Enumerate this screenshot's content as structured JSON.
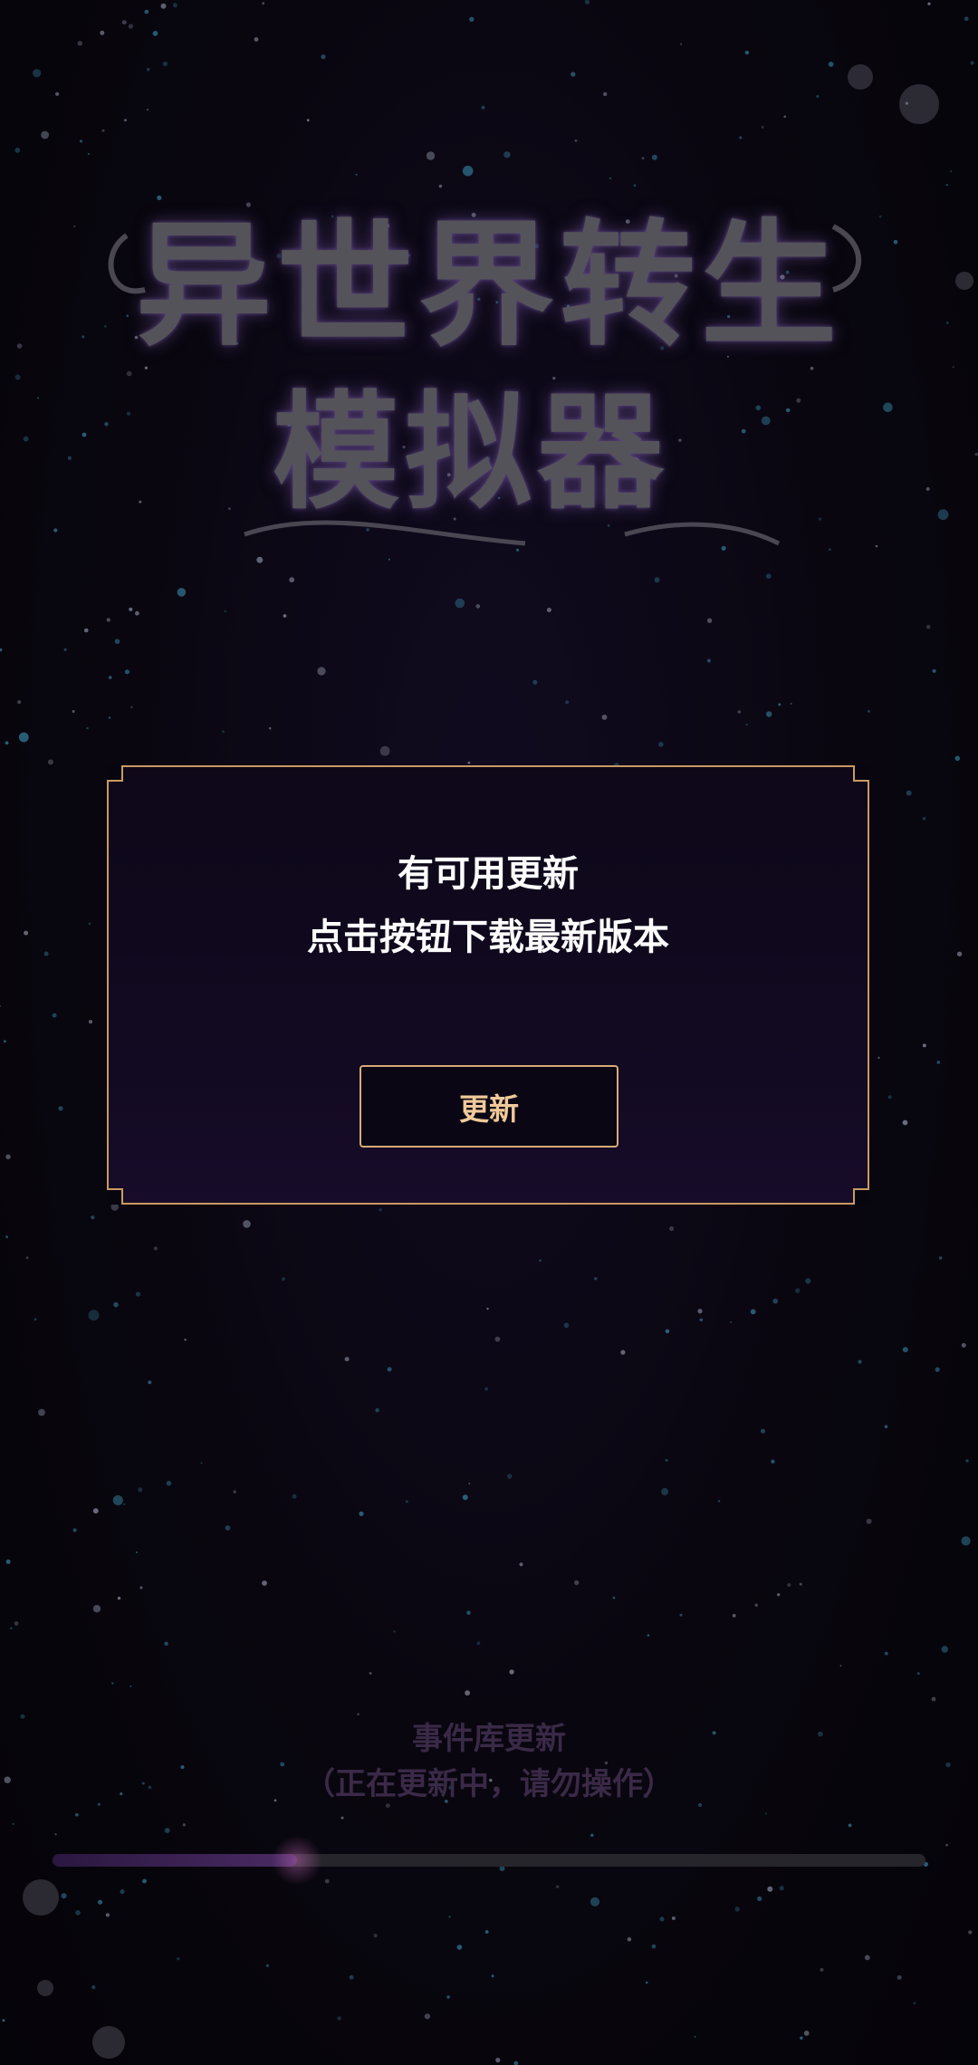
{
  "app": {
    "title_line1": "异世界转生",
    "title_line2": "模拟器"
  },
  "dialog": {
    "title": "有可用更新",
    "message": "点击按钮下载最新版本",
    "button_label": "更新"
  },
  "status": {
    "title": "事件库更新",
    "subtitle": "（正在更新中，请勿操作）",
    "progress_fraction": 0.28
  },
  "colors": {
    "accent_gold": "#c99a62",
    "button_text": "#f0c99a",
    "background": "#07050d"
  }
}
